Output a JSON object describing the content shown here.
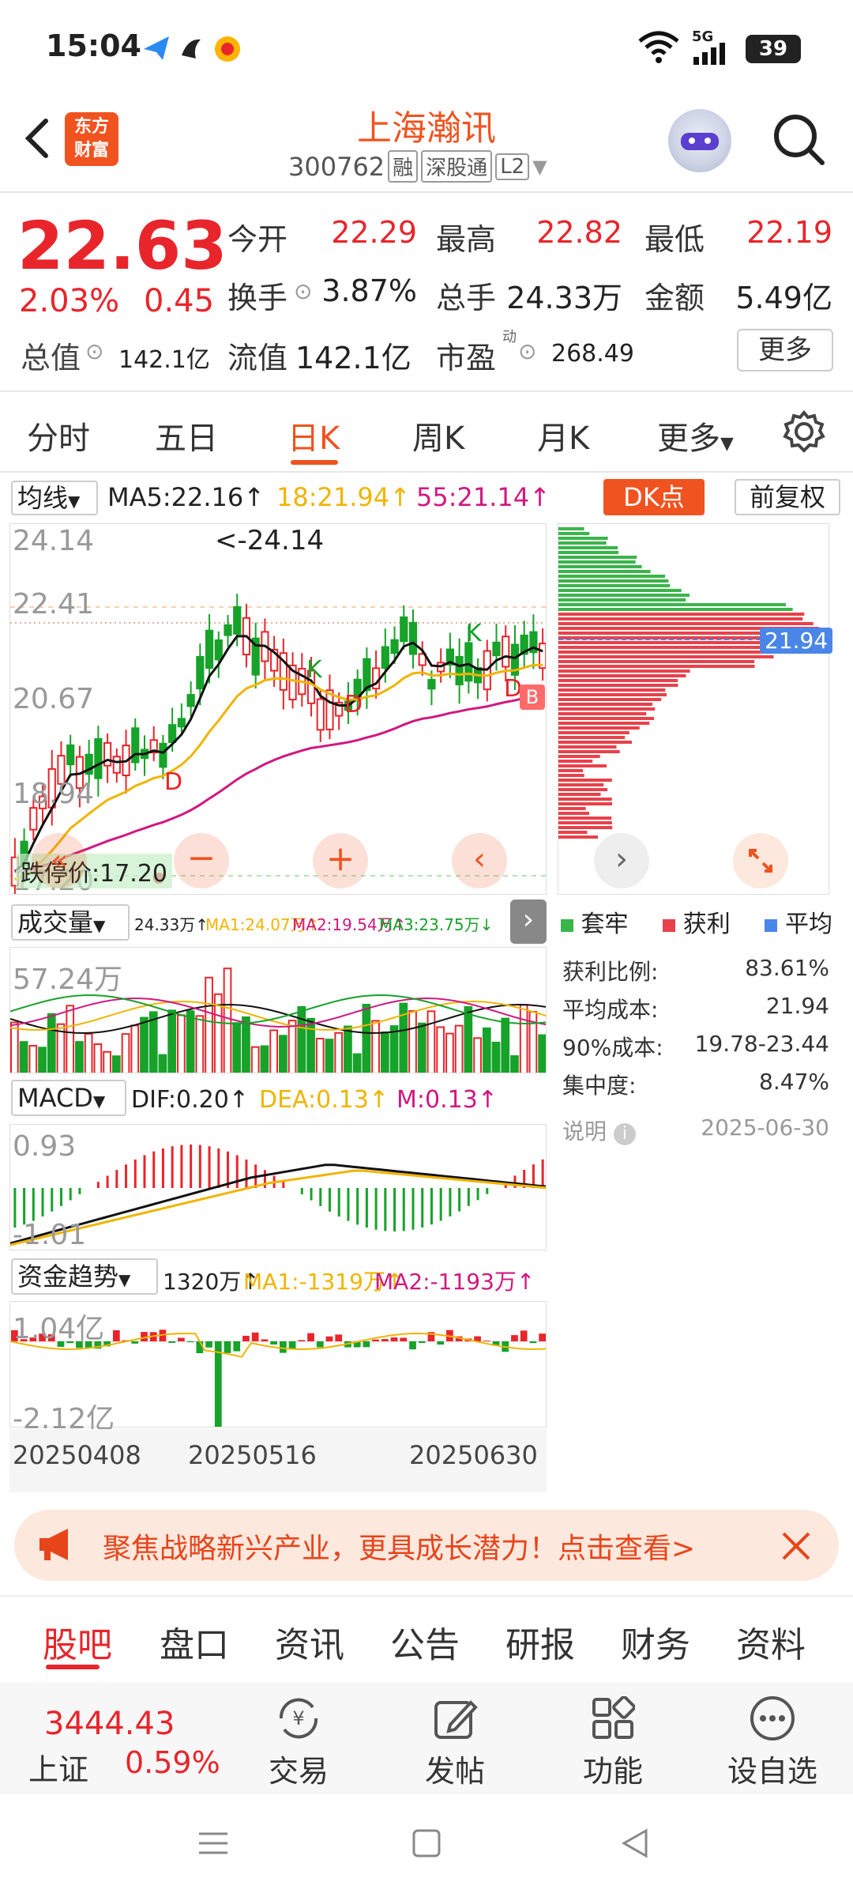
{
  "status": {
    "time": "15:04",
    "network": "5G",
    "battery": "39"
  },
  "header": {
    "brand_line1": "东方",
    "brand_line2": "财富",
    "stock_name": "上海瀚讯",
    "stock_code": "300762",
    "tags": [
      "融",
      "深股通",
      "L2"
    ]
  },
  "quote": {
    "price": "22.63",
    "change_pct": "2.03%",
    "change_amt": "0.45",
    "open_label": "今开",
    "open": "22.29",
    "high_label": "最高",
    "high": "22.82",
    "low_label": "最低",
    "low": "22.19",
    "turnover_label": "换手",
    "turnover": "3.87%",
    "volume_label": "总手",
    "volume": "24.33万",
    "amount_label": "金额",
    "amount": "5.49亿",
    "mktcap_label": "总值",
    "mktcap": "142.1亿",
    "float_label": "流值",
    "float": "142.1亿",
    "pe_label": "市盈",
    "pe_super": "动",
    "pe": "268.49",
    "more_label": "更多"
  },
  "tabs": [
    "分时",
    "五日",
    "日K",
    "周K",
    "月K",
    "更多"
  ],
  "kline": {
    "ma_label": "均线",
    "ma5": "MA5:22.16↑",
    "ma18": "18:21.94↑",
    "ma55": "55:21.14↑",
    "dk_label": "DK点",
    "adjust_label": "前复权",
    "y_ticks": [
      "24.14",
      "22.41",
      "20.67",
      "18.94",
      "17.20"
    ],
    "high_annot": "<-24.14",
    "stop_label": "跌停价:17.20",
    "markers": [
      "K",
      "K",
      "D",
      "D",
      "D",
      "B"
    ]
  },
  "chips": {
    "avg_cost_tag": "21.94",
    "legend": [
      "套牢",
      "获利",
      "平均"
    ],
    "rows": [
      {
        "label": "获利比例:",
        "value": "83.61%"
      },
      {
        "label": "平均成本:",
        "value": "21.94"
      },
      {
        "label": "90%成本:",
        "value": "19.78-23.44"
      },
      {
        "label": "集中度:",
        "value": "8.47%"
      }
    ],
    "note_label": "说明",
    "date": "2025-06-30"
  },
  "volume": {
    "label": "成交量",
    "val": "24.33万↑",
    "ma1": "MA1:24.07万↑",
    "ma2": "MA2:19.54万↑",
    "ma3": "MA3:23.75万↓",
    "tick": "57.24万"
  },
  "macd": {
    "label": "MACD",
    "dif": "DIF:0.20↑",
    "dea": "DEA:0.13↑",
    "m": "M:0.13↑",
    "tick_top": "0.93",
    "tick_bottom": "-1.01"
  },
  "fund": {
    "label": "资金趋势",
    "val": "1320万↑",
    "ma1": "MA1:-1319万↑",
    "ma2": "MA2:-1193万↑",
    "tick_top": "1.04亿",
    "tick_bottom": "-2.12亿"
  },
  "dates": [
    "20250408",
    "20250516",
    "20250630"
  ],
  "banner": {
    "text": "聚焦战略新兴产业，更具成长潜力！点击查看>"
  },
  "bottom_tabs": [
    "股吧",
    "盘口",
    "资讯",
    "公告",
    "研报",
    "财务",
    "资料"
  ],
  "bottom_bar": {
    "index_value": "3444.43",
    "index_name": "上证",
    "index_pct": "0.59%",
    "trade": "交易",
    "post": "发帖",
    "func": "功能",
    "watch": "设自选"
  },
  "colors": {
    "up": "#e8252b",
    "down": "#17a22a",
    "accent": "#f0531f"
  }
}
